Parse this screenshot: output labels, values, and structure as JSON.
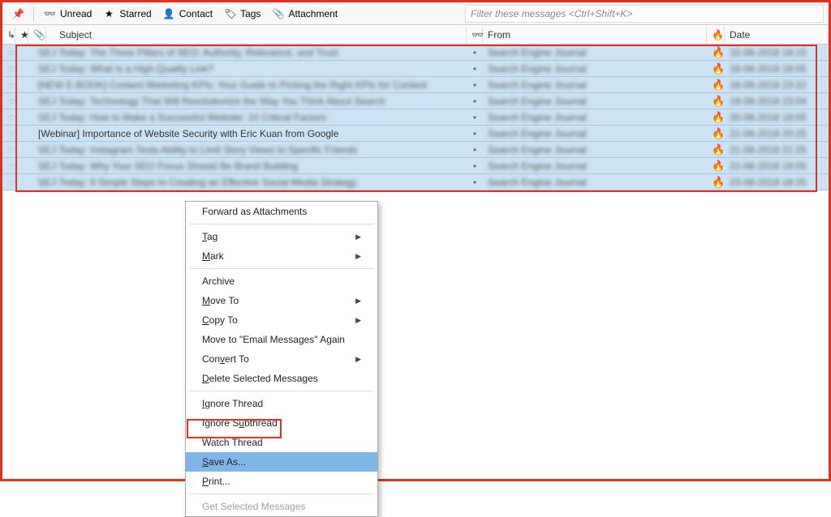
{
  "toolbar": {
    "unread_label": "Unread",
    "starred_label": "Starred",
    "contact_label": "Contact",
    "tags_label": "Tags",
    "attachment_label": "Attachment",
    "search_placeholder": "Filter these messages <Ctrl+Shift+K>"
  },
  "columns": {
    "subject": "Subject",
    "from": "From",
    "date": "Date"
  },
  "messages": [
    {
      "subject": "SEJ Today: The Three Pillars of SEO: Authority, Relevance, and Trust",
      "from": "Search Engine Journal",
      "date": "15-06-2018 18:15",
      "sharp": false
    },
    {
      "subject": "SEJ Today:  What Is a High-Quality Link?",
      "from": "Search Engine Journal",
      "date": "18-06-2018 18:05",
      "sharp": false
    },
    {
      "subject": "[NEW E-BOOK] Content Marketing KPIs: Your Guide to Picking the Right KPIs for Content",
      "from": "Search Engine Journal",
      "date": "18-06-2018 23:22",
      "sharp": false
    },
    {
      "subject": "SEJ Today: Technology That Will Revolutionize the Way You Think About Search",
      "from": "Search Engine Journal",
      "date": "19-06-2018 23:04",
      "sharp": false
    },
    {
      "subject": "SEJ Today: How to Make a Successful Website: 10 Critical Factors",
      "from": "Search Engine Journal",
      "date": "20-06-2018 18:05",
      "sharp": false
    },
    {
      "subject": "[Webinar] Importance of Website Security with Eric Kuan from Google",
      "from": "Search Engine Journal",
      "date": "21-06-2018 20:25",
      "sharp": true
    },
    {
      "subject": "SEJ Today: Instagram Tests Ability to Limit Story Views to Specific Friends",
      "from": "Search Engine Journal",
      "date": "21-06-2018 21:25",
      "sharp": false
    },
    {
      "subject": "SEJ Today: Why Your SEO Focus Should Be Brand Building",
      "from": "Search Engine Journal",
      "date": "22-06-2018 18:05",
      "sharp": false
    },
    {
      "subject": "SEJ Today: 9 Simple Steps to Creating an Effective Social Media Strategy",
      "from": "Search Engine Journal",
      "date": "23-06-2018 18:25",
      "sharp": false
    }
  ],
  "menu": {
    "forward": "Forward as Attachments",
    "tag": "Tag",
    "mark": "Mark",
    "archive": "Archive",
    "moveto": "Move To",
    "copyto": "Copy To",
    "moveagain": "Move to \"Email Messages\" Again",
    "convert": "Convert To",
    "delete": "Delete Selected Messages",
    "ignore_thread": "Ignore Thread",
    "ignore_subthread": "Ignore Subthread",
    "watch_thread": "Watch Thread",
    "saveas": "Save As...",
    "print": "Print...",
    "getselected": "Get Selected Messages"
  },
  "icons": {
    "pin": "📌",
    "glasses": "👓",
    "star": "★",
    "contact": "👤",
    "tag": "🏷",
    "attachment": "📎",
    "thread": "↳",
    "star_outline": "☆",
    "read": "👓",
    "priority": "🔥",
    "dot": "•",
    "arrow": "▶"
  }
}
